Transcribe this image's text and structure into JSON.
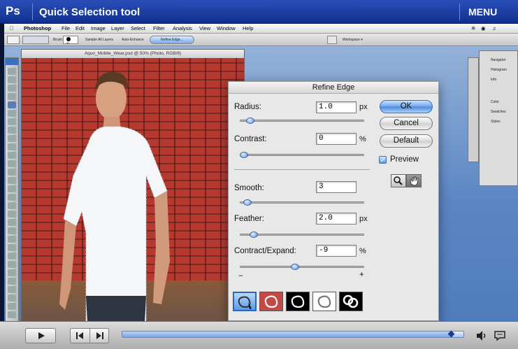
{
  "header": {
    "logo": "Ps",
    "title": "Quick Selection tool",
    "menu_label": "MENU"
  },
  "mac_menu": {
    "app": "Photoshop",
    "items": [
      "File",
      "Edit",
      "Image",
      "Layer",
      "Select",
      "Filter",
      "Analysis",
      "View",
      "Window",
      "Help"
    ]
  },
  "options_bar": {
    "brush_label": "Brush:",
    "brush_size": "30",
    "sample_all_layers": "Sample All Layers",
    "auto_enhance": "Auto-Enhance",
    "refine_edge_button": "Refine Edge...",
    "workspace_label": "Workspace ▾"
  },
  "document": {
    "title": "Aquo_Mobile_Wear.psd @ 50% (Photo, RGB/8)"
  },
  "panels": {
    "items": [
      "Navigator",
      "Histogram",
      "Info",
      "Color",
      "Swatches",
      "Styles"
    ]
  },
  "dialog": {
    "title": "Refine Edge",
    "radius": {
      "label": "Radius:",
      "value": "1.0",
      "unit": "px",
      "level": 0.05
    },
    "contrast": {
      "label": "Contrast:",
      "value": "0",
      "unit": "%",
      "level": 0.0
    },
    "smooth": {
      "label": "Smooth:",
      "value": "3",
      "unit": "",
      "level": 0.03
    },
    "feather": {
      "label": "Feather:",
      "value": "2.0",
      "unit": "px",
      "level": 0.08
    },
    "contract_expand": {
      "label": "Contract/Expand:",
      "value": "-9",
      "unit": "%",
      "level": 0.41
    },
    "minus_label": "−",
    "plus_label": "+",
    "ok_label": "OK",
    "cancel_label": "Cancel",
    "default_label": "Default",
    "preview_label": "Preview",
    "preview_checked": true
  },
  "player": {
    "progress": 0.97
  },
  "colors": {
    "title_bar": "#1d3fa4",
    "accent": "#4c88db"
  }
}
